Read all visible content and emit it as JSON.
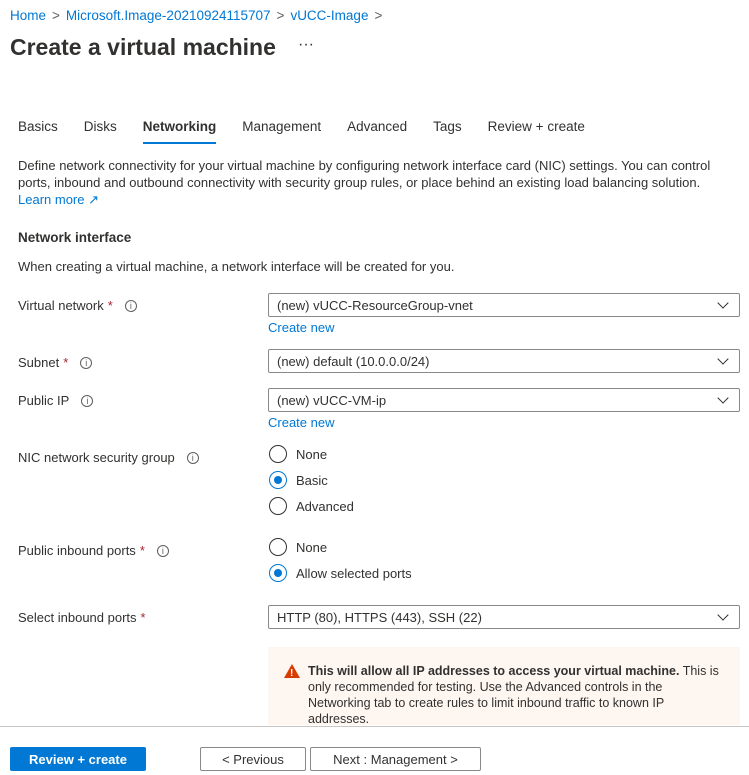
{
  "breadcrumb": [
    "Home",
    "Microsoft.Image-20210924115707",
    "vUCC-Image"
  ],
  "title": "Create a virtual machine",
  "more": "···",
  "tabs": [
    "Basics",
    "Disks",
    "Networking",
    "Management",
    "Advanced",
    "Tags",
    "Review + create"
  ],
  "description": "Define network connectivity for your virtual machine by configuring network interface card (NIC) settings. You can control ports, inbound and outbound connectivity with security group rules, or place behind an existing load balancing solution.",
  "learn_more": "Learn more",
  "section_title": "Network interface",
  "section_sub": "When creating a virtual machine, a network interface will be created for you.",
  "fields": {
    "vnet": {
      "label": "Virtual network",
      "value": "(new) vUCC-ResourceGroup-vnet",
      "link": "Create new"
    },
    "subnet": {
      "label": "Subnet",
      "value": "(new) default (10.0.0.0/24)"
    },
    "pip": {
      "label": "Public IP",
      "value": "(new) vUCC-VM-ip",
      "link": "Create new"
    },
    "nsg": {
      "label": "NIC network security group",
      "options": [
        "None",
        "Basic",
        "Advanced"
      ],
      "selected": "Basic"
    },
    "inbound": {
      "label": "Public inbound ports",
      "options": [
        "None",
        "Allow selected ports"
      ],
      "selected": "Allow selected ports"
    },
    "ports": {
      "label": "Select inbound ports",
      "value": "HTTP (80), HTTPS (443), SSH (22)"
    }
  },
  "warning": {
    "bold": "This will allow all IP addresses to access your virtual machine.",
    "text": " This is only recommended for testing.  Use the Advanced controls in the Networking tab to create rules to limit inbound traffic to known IP addresses."
  },
  "buttons": {
    "review": "Review + create",
    "previous": "< Previous",
    "next": "Next : Management >"
  },
  "colors": {
    "accent": "#0078d4",
    "warning": "#d83b01"
  }
}
